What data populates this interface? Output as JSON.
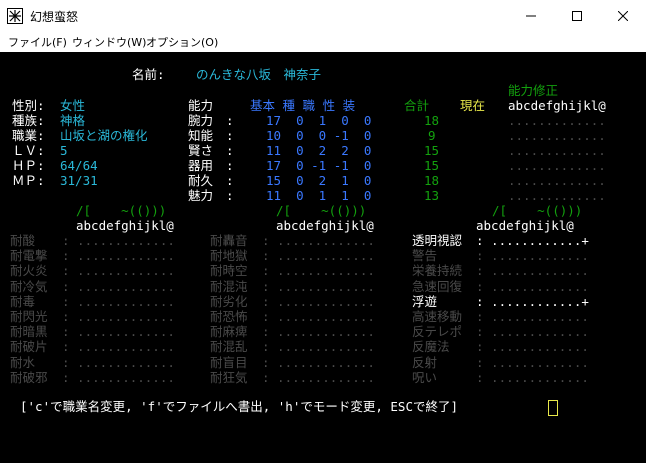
{
  "window": {
    "title": "幻想蛮怒"
  },
  "menu": {
    "file": "ファイル(F)",
    "window": "ウィンドウ(W)",
    "option": "オプション(O)"
  },
  "char": {
    "name_label": "名前:",
    "name": "のんきな八坂　神奈子",
    "bonus_label": "能力修正",
    "bonus_header": "abcdefghijkl@",
    "sex_label": "性別:",
    "sex": "女性",
    "race_label": "種族:",
    "race": "神格",
    "class_label": "職業:",
    "class": "山坂と湖の権化",
    "lv_label": "ＬＶ:",
    "lv": "5",
    "hp_label": "ＨＰ:",
    "hp": "64/64",
    "mp_label": "ＭＰ:",
    "mp": "31/31"
  },
  "stats": {
    "header_label": "能力",
    "col_headers": "基本 種 職 性 装",
    "total_label": "合計",
    "current_label": "現在",
    "rows": [
      {
        "name": "腕力",
        "vals": "17  0  1  0  0",
        "total": "18",
        "dots": "............."
      },
      {
        "name": "知能",
        "vals": "10  0  0 -1  0",
        "total": "9",
        "dots": "............."
      },
      {
        "name": "賢さ",
        "vals": "11  0  2  2  0",
        "total": "15",
        "dots": "............."
      },
      {
        "name": "器用",
        "vals": "17  0 -1 -1  0",
        "total": "15",
        "dots": "............."
      },
      {
        "name": "耐久",
        "vals": "15  0  2  1  0",
        "total": "18",
        "dots": "............."
      },
      {
        "name": "魅力",
        "vals": "11  0  1  1  0",
        "total": "13",
        "dots": "............."
      }
    ]
  },
  "equip": {
    "eq_glyph_1": "/[    ~(()))",
    "eq_glyph_2": "/[    ~(()))",
    "eq_glyph_3": "/[    ~(()))",
    "slots_1": "abcdefghijkl@",
    "slots_2": "abcdefghijkl@",
    "slots_3": "abcdefghijkl@"
  },
  "resist": {
    "col1": [
      {
        "label": "耐酸",
        "dots": ": ............."
      },
      {
        "label": "耐電撃",
        "dots": ": ............."
      },
      {
        "label": "耐火炎",
        "dots": ": ............."
      },
      {
        "label": "耐冷気",
        "dots": ": ............."
      },
      {
        "label": "耐毒",
        "dots": ": ............."
      },
      {
        "label": "耐閃光",
        "dots": ": ............."
      },
      {
        "label": "耐暗黒",
        "dots": ": ............."
      },
      {
        "label": "耐破片",
        "dots": ": ............."
      },
      {
        "label": "耐水",
        "dots": ": ............."
      },
      {
        "label": "耐破邪",
        "dots": ": ............."
      }
    ],
    "col2": [
      {
        "label": "耐轟音",
        "dots": ": ............."
      },
      {
        "label": "耐地獄",
        "dots": ": ............."
      },
      {
        "label": "耐時空",
        "dots": ": ............."
      },
      {
        "label": "耐混沌",
        "dots": ": ............."
      },
      {
        "label": "耐劣化",
        "dots": ": ............."
      },
      {
        "label": "耐恐怖",
        "dots": ": ............."
      },
      {
        "label": "耐麻痺",
        "dots": ": ............."
      },
      {
        "label": "耐混乱",
        "dots": ": ............."
      },
      {
        "label": "耐盲目",
        "dots": ": ............."
      },
      {
        "label": "耐狂気",
        "dots": ": ............."
      }
    ],
    "col3": [
      {
        "label": "透明視認",
        "dots": ": ............+",
        "on": true
      },
      {
        "label": "警告",
        "dots": ": .............",
        "on": false
      },
      {
        "label": "栄養持続",
        "dots": ": .............",
        "on": false
      },
      {
        "label": "急速回復",
        "dots": ": .............",
        "on": false
      },
      {
        "label": "浮遊",
        "dots": ": ............+",
        "on": true
      },
      {
        "label": "高速移動",
        "dots": ": .............",
        "on": false
      },
      {
        "label": "反テレポ",
        "dots": ": .............",
        "on": false
      },
      {
        "label": "反魔法",
        "dots": ": .............",
        "on": false
      },
      {
        "label": "反射",
        "dots": ": .............",
        "on": false
      },
      {
        "label": "呪い",
        "dots": ": .............",
        "on": false
      }
    ]
  },
  "prompt": "['c'で職業名変更, 'f'でファイルへ書出, 'h'でモード変更, ESCで終了]"
}
